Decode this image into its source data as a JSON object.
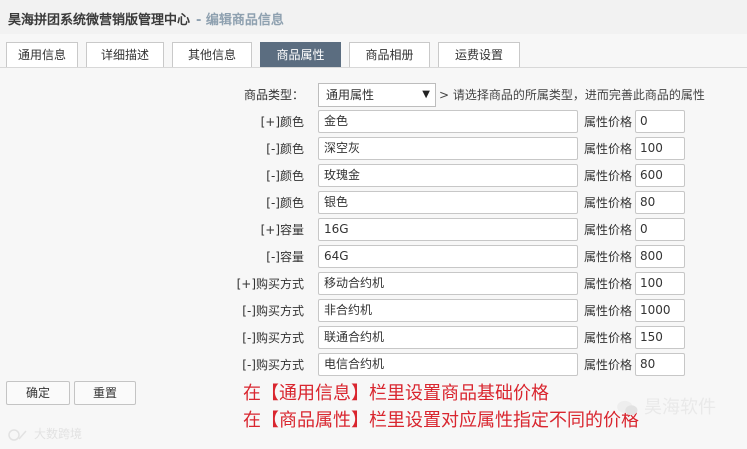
{
  "header": {
    "title": "昊海拼团系统微营销版管理中心",
    "subtitle": "- 编辑商品信息"
  },
  "tabs": [
    {
      "label": "通用信息",
      "active": false
    },
    {
      "label": "详细描述",
      "active": false
    },
    {
      "label": "其他信息",
      "active": false
    },
    {
      "label": "商品属性",
      "active": true
    },
    {
      "label": "商品相册",
      "active": false
    },
    {
      "label": "运费设置",
      "active": false
    }
  ],
  "form": {
    "type_label": "商品类型：",
    "type_value": "通用属性",
    "type_arrow": "▼",
    "type_hint": "> 请选择商品的所属类型，进而完善此商品的属性",
    "price_label": "属性价格",
    "rows": [
      {
        "label": "[+]颜色",
        "value": "金色",
        "price": "0"
      },
      {
        "label": "[-]颜色",
        "value": "深空灰",
        "price": "100"
      },
      {
        "label": "[-]颜色",
        "value": "玫瑰金",
        "price": "600"
      },
      {
        "label": "[-]颜色",
        "value": "银色",
        "price": "80"
      },
      {
        "label": "[+]容量",
        "value": "16G",
        "price": "0"
      },
      {
        "label": "[-]容量",
        "value": "64G",
        "price": "800"
      },
      {
        "label": "[+]购买方式",
        "value": "移动合约机",
        "price": "100"
      },
      {
        "label": "[-]购买方式",
        "value": "非合约机",
        "price": "1000"
      },
      {
        "label": "[-]购买方式",
        "value": "联通合约机",
        "price": "150"
      },
      {
        "label": "[-]购买方式",
        "value": "电信合约机",
        "price": "80"
      }
    ]
  },
  "buttons": {
    "confirm": "确定",
    "reset": "重置"
  },
  "annotations": [
    "在【通用信息】栏里设置商品基础价格",
    "在【商品属性】栏里设置对应属性指定不同的价格"
  ],
  "watermarks": {
    "left": "大数跨境",
    "right": "昊海软件"
  },
  "colors": {
    "active_tab": "#5b6d80",
    "annotation": "#d9262f",
    "subtitle": "#8fa1b0"
  }
}
